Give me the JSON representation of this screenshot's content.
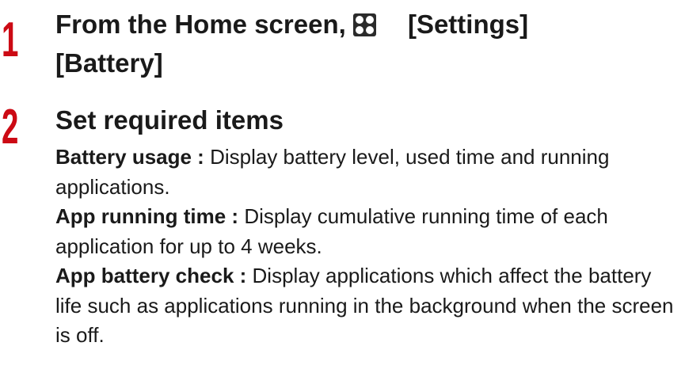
{
  "step1": {
    "number": "1",
    "title_part1": "From the Home screen,",
    "title_part2": "[Settings]",
    "title_part3": "[Battery]",
    "icon": "apps-grid-icon"
  },
  "step2": {
    "number": "2",
    "title": "Set required items",
    "items": [
      {
        "term": "Battery usage :",
        "description": "Display battery level, used time and running applications."
      },
      {
        "term": "App running time :",
        "description": "Display cumulative running time of each application for up to 4 weeks."
      },
      {
        "term": "App battery check :",
        "description": "Display applications which affect the battery life such as applications running in the background when the screen is off."
      }
    ]
  },
  "colors": {
    "step_number": "#cc0a14",
    "text": "#1a1a1a",
    "background": "#ffffff"
  }
}
